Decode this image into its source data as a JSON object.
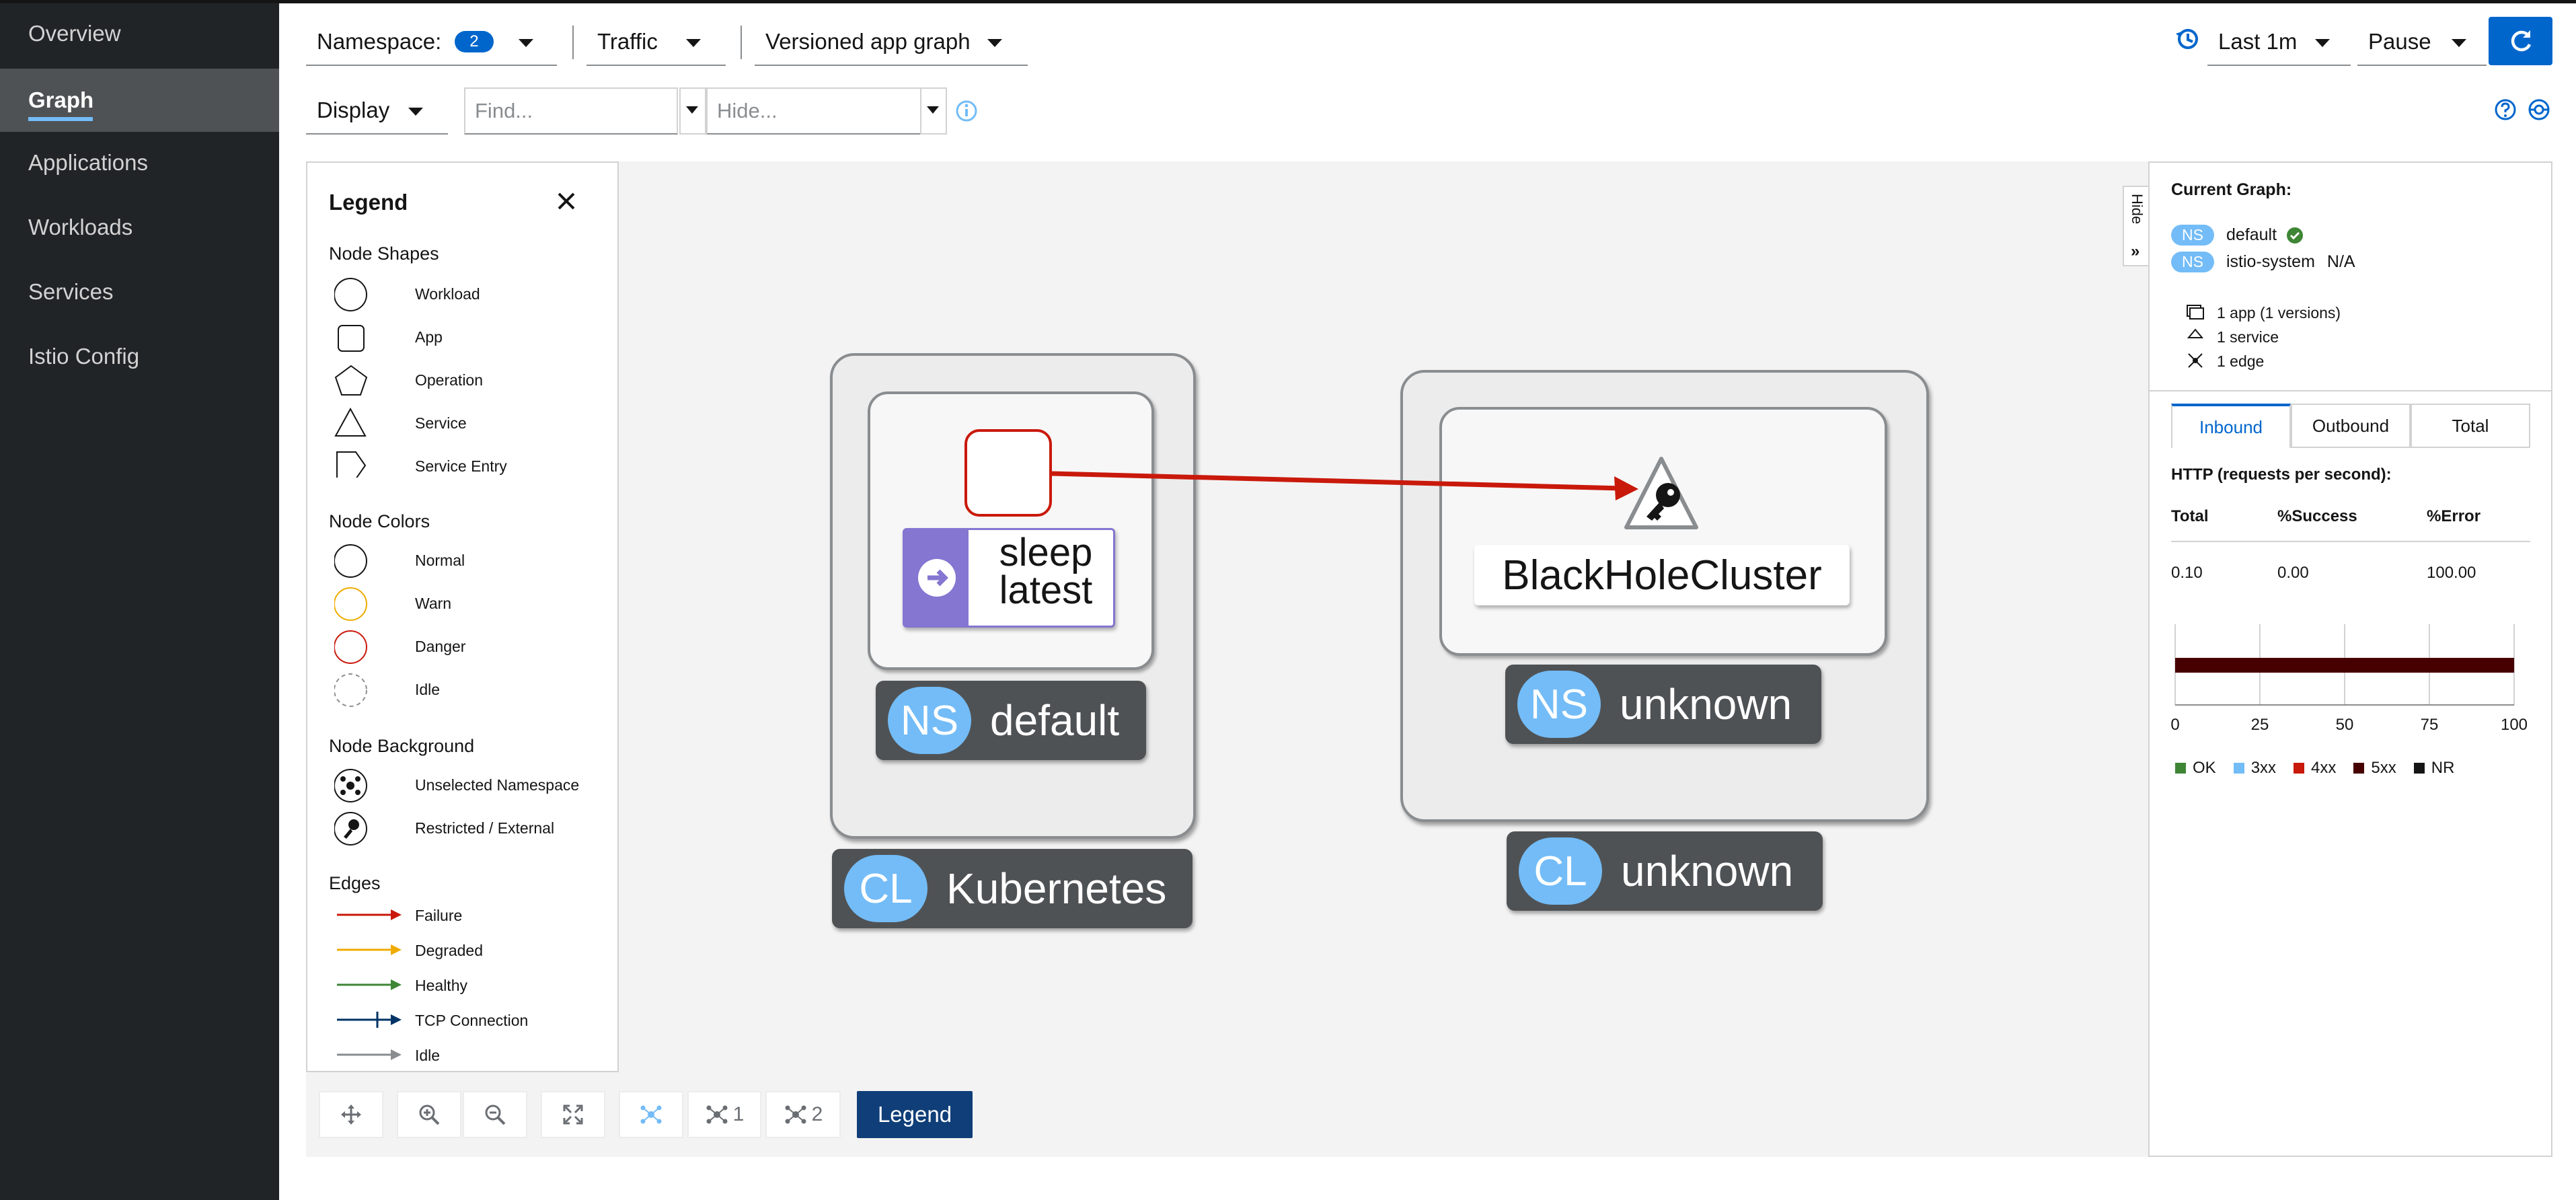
{
  "sidebar": {
    "items": [
      {
        "label": "Overview"
      },
      {
        "label": "Graph"
      },
      {
        "label": "Applications"
      },
      {
        "label": "Workloads"
      },
      {
        "label": "Services"
      },
      {
        "label": "Istio Config"
      }
    ],
    "active": "Graph"
  },
  "toolbar": {
    "namespace_label": "Namespace:",
    "namespace_count": "2",
    "traffic_label": "Traffic",
    "graph_type": "Versioned app graph",
    "duration": "Last 1m",
    "refresh": "Pause",
    "display_label": "Display",
    "find_placeholder": "Find...",
    "hide_placeholder": "Hide..."
  },
  "legend": {
    "title": "Legend",
    "node_shapes_title": "Node Shapes",
    "node_shapes": [
      "Workload",
      "App",
      "Operation",
      "Service",
      "Service Entry"
    ],
    "node_colors_title": "Node Colors",
    "node_colors": [
      "Normal",
      "Warn",
      "Danger",
      "Idle"
    ],
    "node_background_title": "Node Background",
    "node_background": [
      "Unselected Namespace",
      "Restricted / External"
    ],
    "edges_title": "Edges",
    "edges": [
      "Failure",
      "Degraded",
      "Healthy",
      "TCP Connection",
      "Idle"
    ]
  },
  "graph": {
    "app_node_label_line1": "sleep",
    "app_node_label_line2": "latest",
    "ns_default": "default",
    "cluster_kubernetes": "Kubernetes",
    "service_node_label": "BlackHoleCluster",
    "ns_unknown": "unknown",
    "cluster_unknown": "unknown",
    "ns_prefix": "NS",
    "cl_prefix": "CL"
  },
  "side_panel": {
    "hide_label": "Hide",
    "current_graph_title": "Current Graph:",
    "namespaces": [
      {
        "prefix": "NS",
        "name": "default",
        "status": ""
      },
      {
        "prefix": "NS",
        "name": "istio-system",
        "status": "N/A"
      }
    ],
    "summary": [
      "1 app (1 versions)",
      "1 service",
      "1 edge"
    ],
    "tabs": [
      "Inbound",
      "Outbound",
      "Total"
    ],
    "active_tab": "Inbound",
    "http_title": "HTTP (requests per second):",
    "table_headers": [
      "Total",
      "%Success",
      "%Error"
    ],
    "table_values": [
      "0.10",
      "0.00",
      "100.00"
    ],
    "chart_ticks": [
      "0",
      "25",
      "50",
      "75",
      "100"
    ],
    "chart_legend": [
      "OK",
      "3xx",
      "4xx",
      "5xx",
      "NR"
    ],
    "chart_colors": {
      "OK": "#3e8635",
      "3xx": "#73bcf7",
      "4xx": "#c9190b",
      "5xx": "#470000",
      "NR": "#151515"
    },
    "error_fraction": 1.0
  },
  "bottom_toolbar": {
    "namespace_layout_1": "1",
    "namespace_layout_2": "2",
    "legend_button": "Legend"
  },
  "colors": {
    "accent": "#0066cc",
    "failure": "#c9190b",
    "degraded": "#f0ab00",
    "healthy": "#3e8635",
    "tcp": "#003366",
    "idle": "#8a8d90"
  }
}
